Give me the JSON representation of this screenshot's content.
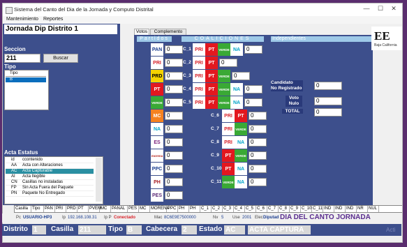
{
  "window": {
    "title": "Sistema del Canto del Dia de la Jornada y Computo Distrital",
    "minimize_icon": "minimize-icon",
    "maximize_icon": "maximize-icon",
    "close_icon": "close-icon"
  },
  "menu": {
    "items": [
      "Mantenimiento",
      "Reportes"
    ]
  },
  "left": {
    "district_title": "Jornada Dip Distrito 1",
    "seccion_label": "Seccion",
    "seccion_value": "211",
    "buscar_label": "Buscar",
    "tipo_label": "Tipo",
    "tipo_header": "Tipo",
    "tipo_selected": "B",
    "acta_label": "Acta Estatus",
    "acta_header": [
      "id",
      "ccontenido"
    ],
    "acta_rows": [
      [
        "AA",
        "Acta con Alteraciones"
      ],
      [
        "AC",
        "Acta Capturable"
      ],
      [
        "AI",
        "Acta Ilegible"
      ],
      [
        "CN",
        "Casillas no instaladas"
      ],
      [
        "FP",
        "Sin Acta Fuera del Paquete"
      ],
      [
        "PN",
        "Paquete No Entregado"
      ]
    ]
  },
  "tabs": [
    "Votos",
    "Complemento Acta"
  ],
  "headers": {
    "partidos": "Partidos",
    "coaliciones": "COALICIONES",
    "independientes": "Independientes"
  },
  "parties": [
    {
      "name": "PAN",
      "value": "0",
      "bg": "#ffffff",
      "fg": "#1a3d8f"
    },
    {
      "name": "PRI",
      "value": "0",
      "bg": "#ffffff",
      "fg": "#d8232a"
    },
    {
      "name": "PRD",
      "value": "0",
      "bg": "#f5d300",
      "fg": "#000000"
    },
    {
      "name": "PT",
      "value": "0",
      "bg": "#e3181f",
      "fg": "#ffffff"
    },
    {
      "name": "VERDE",
      "value": "0",
      "bg": "#3aa935",
      "fg": "#ffffff"
    },
    {
      "name": "MC",
      "value": "0",
      "bg": "#f58220",
      "fg": "#ffffff"
    },
    {
      "name": "NA",
      "value": "0",
      "bg": "#ffffff",
      "fg": "#00a3c9"
    },
    {
      "name": "ES",
      "value": "0",
      "bg": "#ffffff",
      "fg": "#7a1f7a"
    },
    {
      "name": "morena",
      "value": "0",
      "bg": "#ffffff",
      "fg": "#b5261e"
    },
    {
      "name": "PPC",
      "value": "0",
      "bg": "#ffffff",
      "fg": "#1a3d8f"
    },
    {
      "name": "PH",
      "value": "0",
      "bg": "#ffffff",
      "fg": "#a61c22"
    },
    {
      "name": "PES",
      "value": "0",
      "bg": "#ffffff",
      "fg": "#5e2d79"
    }
  ],
  "coalitions": [
    {
      "label": "C_1",
      "logos": [
        "PRI",
        "PT",
        "VERDE",
        "NA"
      ],
      "value": "0"
    },
    {
      "label": "C_2",
      "logos": [
        "PRI",
        "PT"
      ],
      "value": "0"
    },
    {
      "label": "C_3",
      "logos": [
        "PRI",
        "PT",
        "VERDE"
      ],
      "value": "0"
    },
    {
      "label": "C_4",
      "logos": [
        "PRI",
        "PT",
        "VERDE",
        "NA"
      ],
      "value": "0"
    },
    {
      "label": "C_5",
      "logos": [
        "PRI",
        "PT",
        "VERDE",
        "NA"
      ],
      "value": "0"
    },
    {
      "label": "C_6",
      "logos": [
        "PRI",
        "PT"
      ],
      "value": "0"
    },
    {
      "label": "C_7",
      "logos": [
        "PRI",
        "VERDE"
      ],
      "value": "0"
    },
    {
      "label": "C_8",
      "logos": [
        "PRI",
        "NA"
      ],
      "value": "0"
    },
    {
      "label": "C_9",
      "logos": [
        "PT",
        "VERDE"
      ],
      "value": "0"
    },
    {
      "label": "C_10",
      "logos": [
        "PT",
        "NA"
      ],
      "value": "0"
    },
    {
      "label": "C_11",
      "logos": [
        "VERDE",
        "NA"
      ],
      "value": "0"
    }
  ],
  "independent": {
    "candidato_label": "Candidato\nNo Registrado",
    "candidato_value": "0",
    "nulo_label": "Voto\nNulo",
    "nulo_value": "0",
    "total_label": "TOTAL",
    "total_value": "0"
  },
  "brand": {
    "logo_text": "EE",
    "logo_sub": "Baja California"
  },
  "grid_headers": [
    "Casilla",
    "Tipo",
    "PAN",
    "PRI",
    "PRD",
    "PT",
    "PVEM",
    "MC",
    "PANAL",
    "PES",
    "MC",
    "MORENA",
    "PPC",
    "PH",
    "PH",
    "C_1",
    "C_2",
    "C_3",
    "C_4",
    "C_5",
    "C_6",
    "C_7",
    "C_8",
    "C_9",
    "C_10",
    "C_11",
    "IND",
    "IND",
    "IND",
    "NR",
    "NUL"
  ],
  "info": {
    "pc_label": "Pc",
    "pc_value": "USUARIO-HP3",
    "ip_label": "Ip",
    "ip_value": "192.168.108.31",
    "ipp_label": "Ip P",
    "ipp_value": "Conectado",
    "mac_label": "Mac",
    "mac_value": "8C6E9E7500000",
    "nv_label": "Nv",
    "nv_value": "5",
    "use_label": "Use",
    "use_value": "2001",
    "elec_label": "Elec",
    "elec_value": "Diputad",
    "banner": "DIA DEL CANTO JORNADA"
  },
  "status": {
    "distrito_label": "Distrito",
    "distrito_value": "1",
    "casilla_label": "Casilla",
    "casilla_value": "211",
    "tipo_label": "Tipo",
    "tipo_value": "B",
    "cabecera_label": "Cabecera",
    "cabecera_value": "2",
    "estado_label": "Estado",
    "estado_value": "AC",
    "acta_value": "ACTA CAPTURA",
    "ghost": "Acti"
  }
}
